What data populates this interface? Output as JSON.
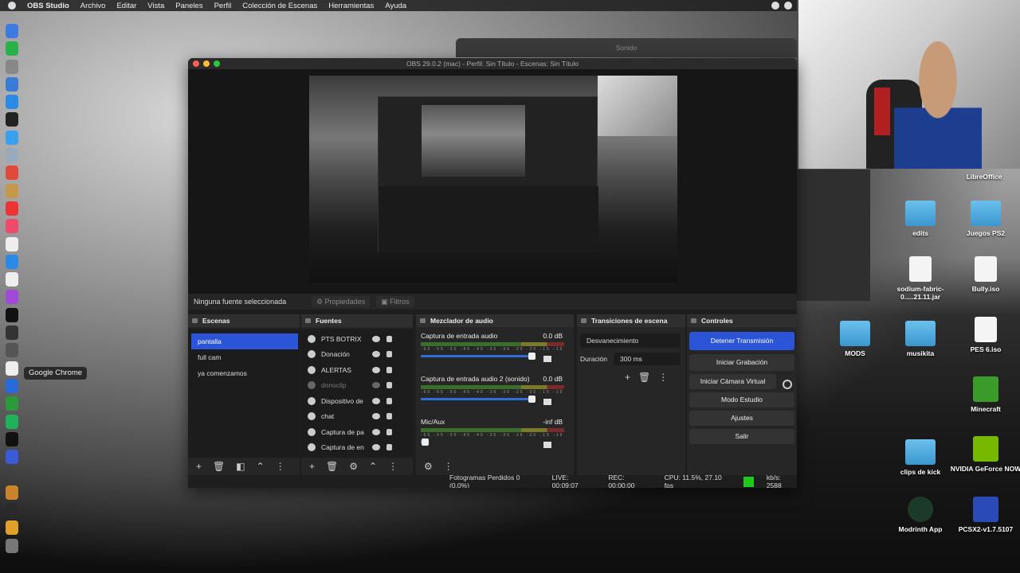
{
  "menubar": {
    "app": "OBS Studio",
    "items": [
      "Archivo",
      "Editar",
      "Vista",
      "Paneles",
      "Perfil",
      "Colección de Escenas",
      "Herramientas",
      "Ayuda"
    ]
  },
  "dock_tooltip": "Google Chrome",
  "background_window": {
    "title": "Sonido"
  },
  "desktop": {
    "header_label": "LibreOffice",
    "icons": [
      {
        "label": "edits",
        "icon": "folder-icon"
      },
      {
        "label": "Juegos PS2",
        "icon": "folder-icon"
      },
      {
        "label": "sodium-fabric-0.....21.11.jar",
        "icon": "jar-file-icon"
      },
      {
        "label": "Bully.iso",
        "icon": "disk-image-icon"
      },
      {
        "label": "MODS",
        "icon": "folder-icon"
      },
      {
        "label": "musikita",
        "icon": "folder-icon"
      },
      {
        "label": "PES 6.iso",
        "icon": "disk-image-icon"
      },
      {
        "label": "Minecraft",
        "icon": "minecraft-icon"
      },
      {
        "label": "clips de kick",
        "icon": "folder-icon"
      },
      {
        "label": "NVIDIA GeForce NOW",
        "icon": "nvidia-icon"
      },
      {
        "label": "Modrinth App",
        "icon": "modrinth-icon"
      },
      {
        "label": "PCSX2-v1.7.5107",
        "icon": "pcsx2-icon"
      }
    ]
  },
  "obs": {
    "title": "OBS 29.0.2 (mac) - Perfil: Sin Título - Escenas: Sin Título",
    "source_bar": {
      "none_selected": "Ninguna fuente seleccionada",
      "properties": "Propiedades",
      "filters": "Filtros"
    },
    "scenes": {
      "header": "Escenas",
      "items": [
        "pantalla",
        "full cam",
        "ya comenzamos"
      ]
    },
    "sources": {
      "header": "Fuentes",
      "items": [
        "PTS BOTRIX",
        "Donación",
        "ALERTAS",
        "donoclip",
        "Dispositivo de",
        "chat",
        "Captura de pa",
        "Captura de en"
      ]
    },
    "mixer": {
      "header": "Mezclador de audio",
      "tracks": [
        {
          "name": "Captura de entrada audio",
          "db": "0.0 dB",
          "level": 0.92
        },
        {
          "name": "Captura de entrada audio 2 (sonido)",
          "db": "0.0 dB",
          "level": 0.92
        },
        {
          "name": "Mic/Aux",
          "db": "-inf dB",
          "level": 0.04
        }
      ],
      "ticks": "-60 -55 -50 -45 -40 -35 -30 -25 -20 -15 -10 -5 0"
    },
    "transitions": {
      "header": "Transiciones de escena",
      "selected": "Desvanecimiento",
      "duration_label": "Duración",
      "duration_value": "300 ms"
    },
    "controls": {
      "header": "Controles",
      "stop_stream": "Detener Transmisión",
      "start_recording": "Iniciar Grabación",
      "start_virtual_cam": "Iniciar Cámara Virtual",
      "studio_mode": "Modo Estudio",
      "settings": "Ajustes",
      "exit": "Salir"
    },
    "status": {
      "dropped": "Fotogramas Perdidos 0 (0.0%)",
      "live": "LIVE: 00:09:07",
      "rec": "REC: 00:00:00",
      "cpu": "CPU: 11.5%, 27.10 fps",
      "kbs": "kb/s: 2588"
    }
  }
}
